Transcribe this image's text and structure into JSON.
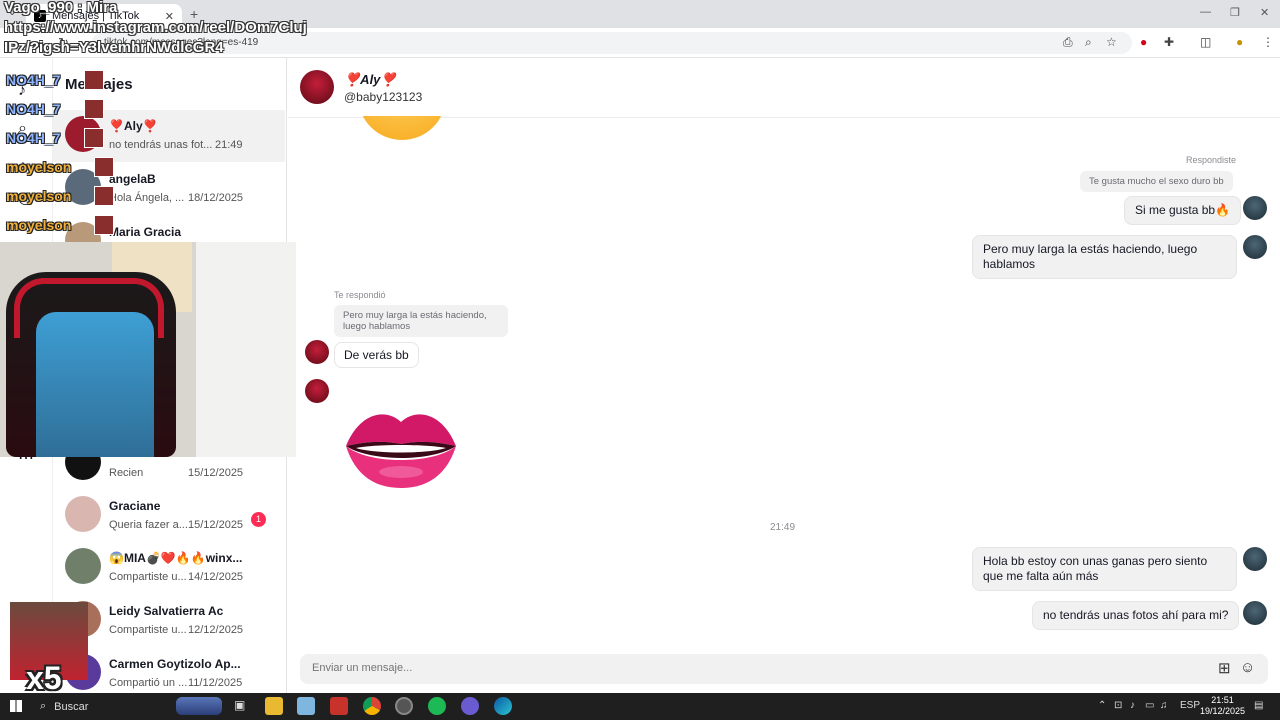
{
  "browser": {
    "tab_title": "Mensajes | TikTok",
    "url": "tiktok.com/messages?lang=es-419"
  },
  "sidebar": {
    "title": "Mensajes",
    "conversations": [
      {
        "name": "❣️Aly❣️",
        "preview": "no tendrás unas fot...",
        "time": "21:49",
        "active": true,
        "color": "#9c1b2c"
      },
      {
        "name": "angelaB",
        "preview": "Hola Ángela, ...",
        "time": "18/12/2025",
        "active": false,
        "color": "#5a6a7a"
      },
      {
        "name": "Maria Gracia",
        "preview": "",
        "time": "",
        "active": false,
        "color": "#b89a7a"
      },
      {
        "name": "",
        "preview": "Recien",
        "time": "15/12/2025",
        "active": false,
        "color": "#111111"
      },
      {
        "name": "Graciane",
        "preview": "Queria fazer a...",
        "time": "15/12/2025",
        "active": false,
        "color": "#d9b7b0",
        "badge": "1"
      },
      {
        "name": "😱MIA💣❤️🔥🔥winx...",
        "preview": "Compartiste u...",
        "time": "14/12/2025",
        "active": false,
        "color": "#6f7f6a"
      },
      {
        "name": "Leidy Salvatierra Ac",
        "preview": "Compartiste u...",
        "time": "12/12/2025",
        "active": false,
        "color": "#a86f5a"
      },
      {
        "name": "Carmen Goytizolo Ap...",
        "preview": "Compartió un ...",
        "time": "11/12/2025",
        "active": false,
        "color": "#5a3a9a"
      }
    ]
  },
  "chat": {
    "name": "❣️Aly❣️",
    "handle": "@baby123123",
    "responded_label": "Respondiste",
    "quoted_out": "Te gusta mucho el sexo duro bb",
    "msg_out_1": "Si me gusta bb🔥",
    "msg_out_2_line1": "Pero muy larga la estás haciendo, luego",
    "msg_out_2_line2": "hablamos",
    "replied_label": "Te respondió",
    "quoted_in_line1": "Pero muy larga la estás haciendo,",
    "quoted_in_line2": "luego hablamos",
    "msg_in_1": "De verás bb",
    "timestamp": "21:49",
    "msg_out_3_line1": "Hola bb estoy con unas ganas pero siento",
    "msg_out_3_line2": "que me falta aún más",
    "msg_out_4": "no tendrás unas fotos ahí para mi?",
    "composer_placeholder": "Enviar un mensaje..."
  },
  "overlay": {
    "line1": "Vago_990 : Mira",
    "line2": "https://www.instagram.com/reel/DOm7Cluj",
    "line3": "IPz/?igsh=Y3lvemhrNWdlcGR4",
    "feed": [
      {
        "user": "NO4H_7",
        "color": "blue"
      },
      {
        "user": "NO4H_7",
        "color": "blue"
      },
      {
        "user": "NO4H_7",
        "color": "blue"
      },
      {
        "user": "moyelson",
        "color": "orange"
      },
      {
        "user": "moyelson",
        "color": "orange"
      },
      {
        "user": "moyelson",
        "color": "orange"
      }
    ],
    "multiplier": "x5"
  },
  "taskbar": {
    "search_label": "Buscar",
    "lang": "ESP",
    "time": "21:51",
    "date": "19/12/2025"
  }
}
